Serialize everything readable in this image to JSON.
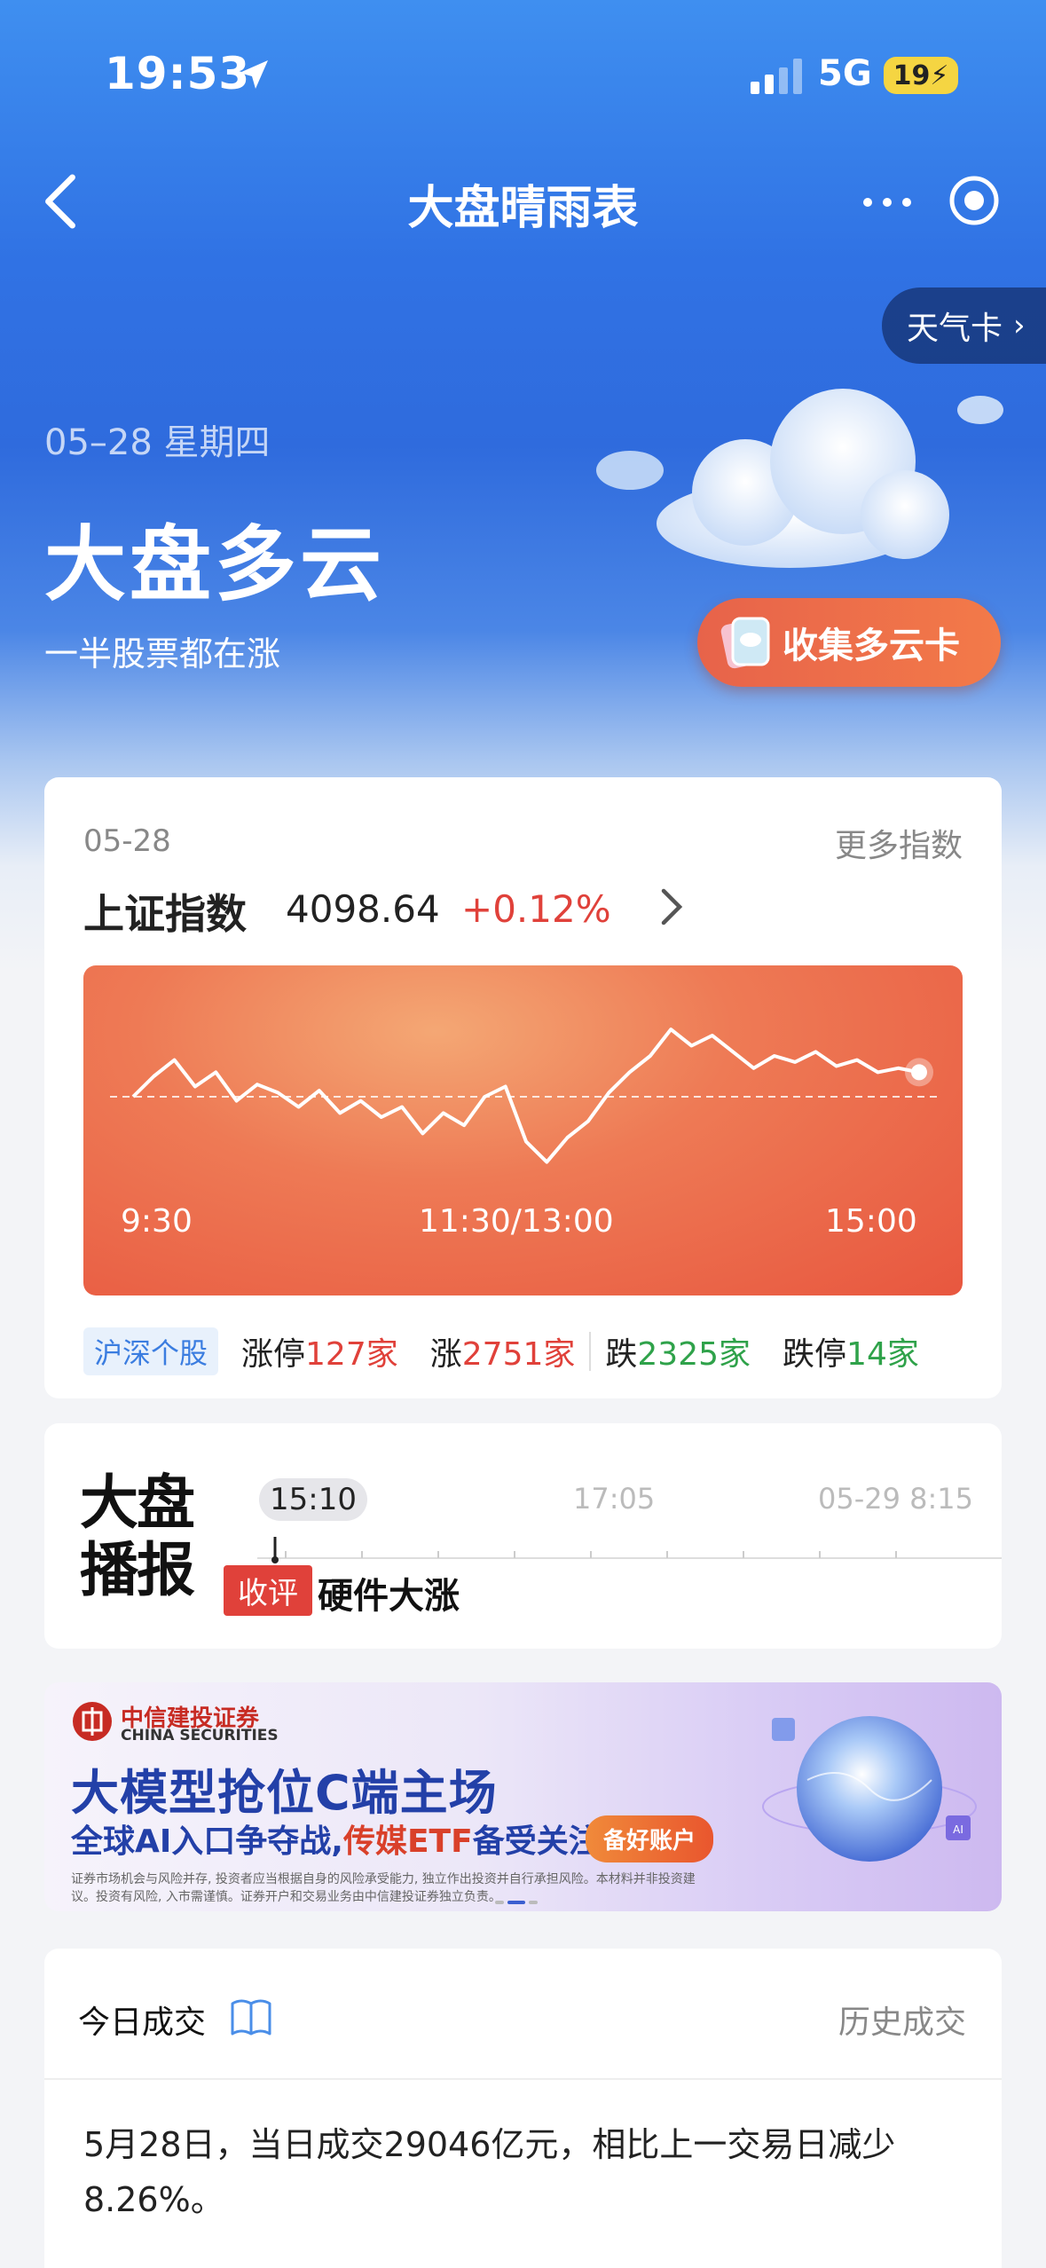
{
  "status_bar": {
    "time": "19:53",
    "network": "5G",
    "battery": "19"
  },
  "nav": {
    "title": "大盘晴雨表"
  },
  "weather_card": {
    "label": "天气卡"
  },
  "hero": {
    "date": "05–28  星期四",
    "title": "大盘多云",
    "subtitle": "一半股票都在涨",
    "collect_label": "收集多云卡"
  },
  "index_card": {
    "date": "05-28",
    "more": "更多指数",
    "name": "上证指数",
    "value": "4098.64",
    "change": "+0.12%",
    "x_ticks": [
      "9:30",
      "11:30/13:00",
      "15:00"
    ],
    "market_tag": "沪深个股",
    "stats": {
      "limit_up_label": "涨停",
      "limit_up_value": "127家",
      "up_label": "涨",
      "up_value": "2751家",
      "down_label": "跌",
      "down_value": "2325家",
      "limit_down_label": "跌停",
      "limit_down_value": "14家"
    }
  },
  "chart_data": {
    "type": "line",
    "title": "",
    "x_ticks": [
      "9:30",
      "11:30/13:00",
      "15:00"
    ],
    "series": [
      {
        "values": [
          0.0,
          0.1,
          0.18,
          0.05,
          0.12,
          -0.02,
          0.06,
          0.02,
          -0.05,
          0.03,
          -0.08,
          -0.02,
          -0.1,
          -0.05,
          -0.18,
          -0.08,
          -0.14,
          0.0,
          0.05,
          -0.22,
          -0.32,
          -0.2,
          -0.12,
          0.02,
          0.12,
          0.2,
          0.33,
          0.25,
          0.3,
          0.22,
          0.14,
          0.2,
          0.17,
          0.22,
          0.15,
          0.18,
          0.12,
          0.14,
          0.12
        ]
      }
    ],
    "baseline": 0,
    "colors": {
      "line": "#ffffff",
      "background": "#ec6a4b"
    }
  },
  "broadcast": {
    "logo_line1": "大盘",
    "logo_line2": "播报",
    "time_active": "15:10",
    "time_2": "17:05",
    "time_3": "05-29 8:15",
    "tag": "收评",
    "headline": "硬件大涨"
  },
  "ad": {
    "brand": "中信建投证券",
    "brand_en": "CHINA SECURITIES",
    "title": "大模型抢位C端主场",
    "sub_prefix": "全球AI入口争夺战,",
    "sub_highlight": "传媒ETF",
    "sub_suffix": "备受关注",
    "cta": "备好账户",
    "disclaimer": "证券市场机会与风险并存, 投资者应当根据自身的风险承受能力, 独立作出投资并自行承担风险。本材料并非投资建议。投资有风险, 入市需谨慎。证券开户和交易业务由中信建投证券独立负责。"
  },
  "volume": {
    "title": "今日成交",
    "history": "历史成交",
    "text": "5月28日，当日成交29046亿元，相比上一交易日减少8.26%。"
  },
  "colors": {
    "up": "#e0413a",
    "down": "#2fa24a",
    "accent": "#3b7de0"
  }
}
